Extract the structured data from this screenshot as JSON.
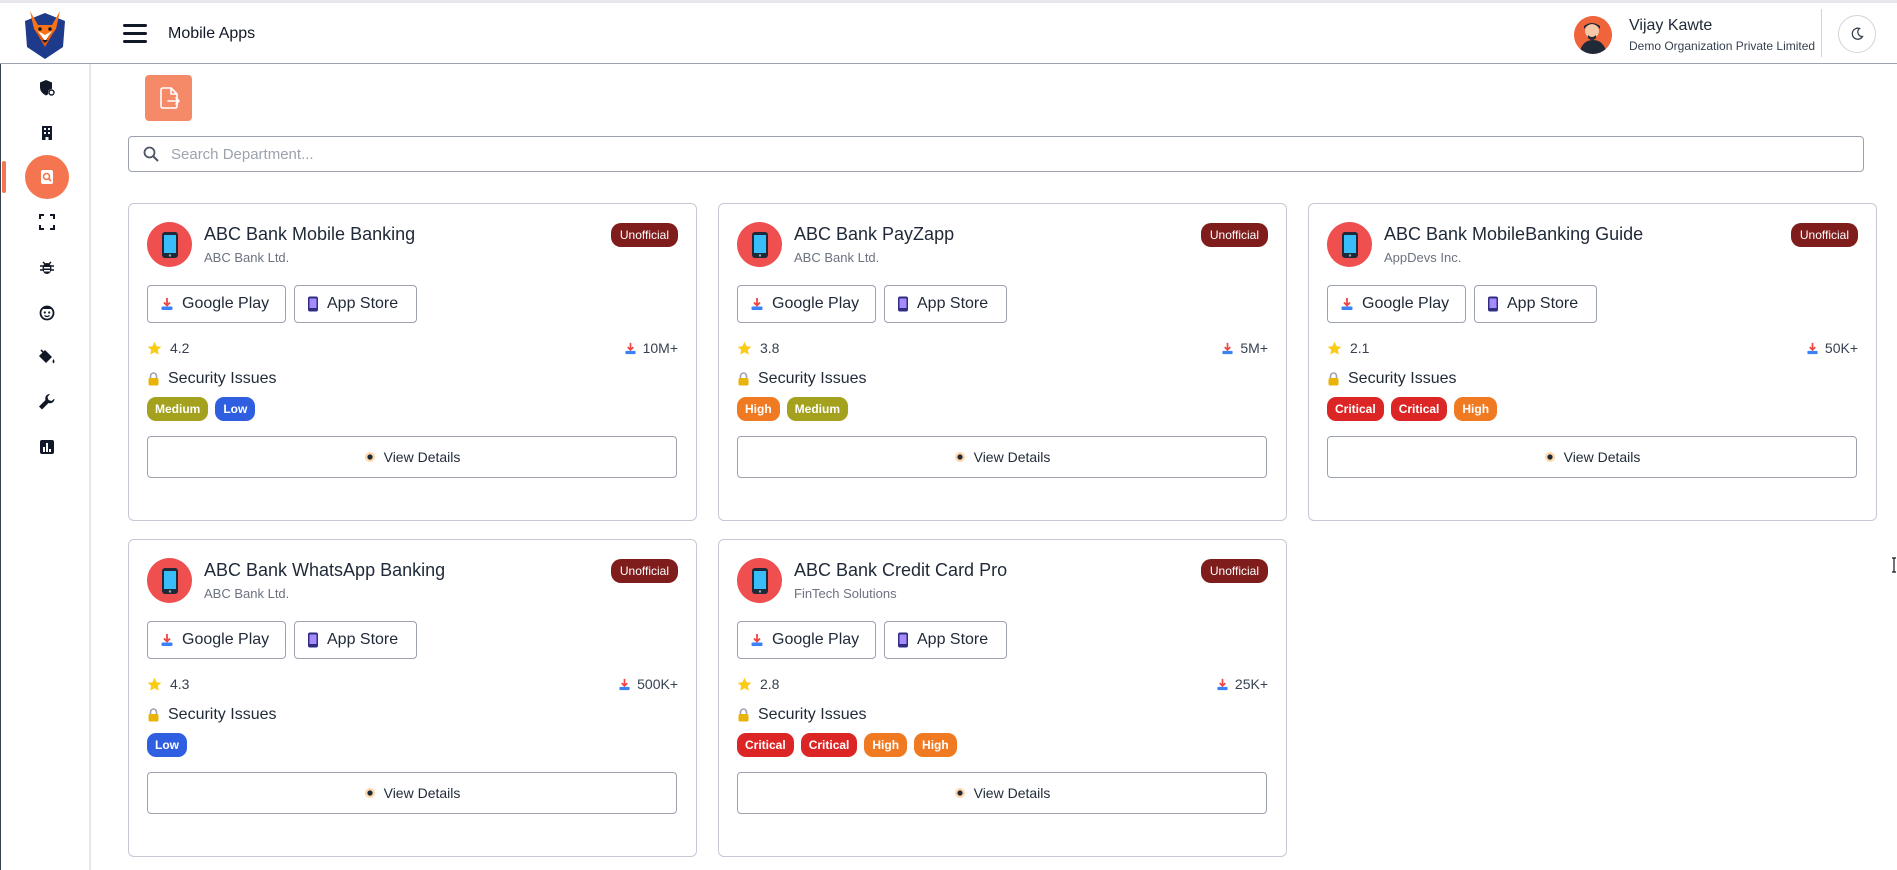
{
  "header": {
    "page_title": "Mobile Apps",
    "user_name": "Vijay Kawte",
    "user_org": "Demo Organization Private Limited"
  },
  "search": {
    "placeholder": "Search Department..."
  },
  "sidebar": {
    "items": [
      {
        "icon": "shield-gear-icon"
      },
      {
        "icon": "building-icon"
      },
      {
        "icon": "search-document-icon",
        "active": true
      },
      {
        "icon": "fullscreen-icon"
      },
      {
        "icon": "bug-icon"
      },
      {
        "icon": "face-icon"
      },
      {
        "icon": "paint-bucket-icon"
      },
      {
        "icon": "wrench-icon"
      },
      {
        "icon": "bar-chart-icon"
      }
    ]
  },
  "labels": {
    "google_play": "Google Play",
    "app_store": "App Store",
    "security_issues": "Security Issues",
    "view_details": "View Details",
    "unofficial": "Unofficial"
  },
  "apps": [
    {
      "name": "ABC Bank Mobile Banking",
      "developer": "ABC Bank Ltd.",
      "rating": "4.2",
      "downloads": "10M+",
      "issues": [
        "Medium",
        "Low"
      ]
    },
    {
      "name": "ABC Bank PayZapp",
      "developer": "ABC Bank Ltd.",
      "rating": "3.8",
      "downloads": "5M+",
      "issues": [
        "High",
        "Medium"
      ]
    },
    {
      "name": "ABC Bank MobileBanking Guide",
      "developer": "AppDevs Inc.",
      "rating": "2.1",
      "downloads": "50K+",
      "issues": [
        "Critical",
        "Critical",
        "High"
      ]
    },
    {
      "name": "ABC Bank WhatsApp Banking",
      "developer": "ABC Bank Ltd.",
      "rating": "4.3",
      "downloads": "500K+",
      "issues": [
        "Low"
      ]
    },
    {
      "name": "ABC Bank Credit Card Pro",
      "developer": "FinTech Solutions",
      "rating": "2.8",
      "downloads": "25K+",
      "issues": [
        "Critical",
        "Critical",
        "High",
        "High"
      ]
    }
  ],
  "colors": {
    "accent": "#f4754f",
    "unofficial_badge": "#7f1d1d",
    "severity_low": "#2f5fe0",
    "severity_medium": "#a3a11d",
    "severity_high": "#f07a22",
    "severity_critical": "#dc2626"
  }
}
